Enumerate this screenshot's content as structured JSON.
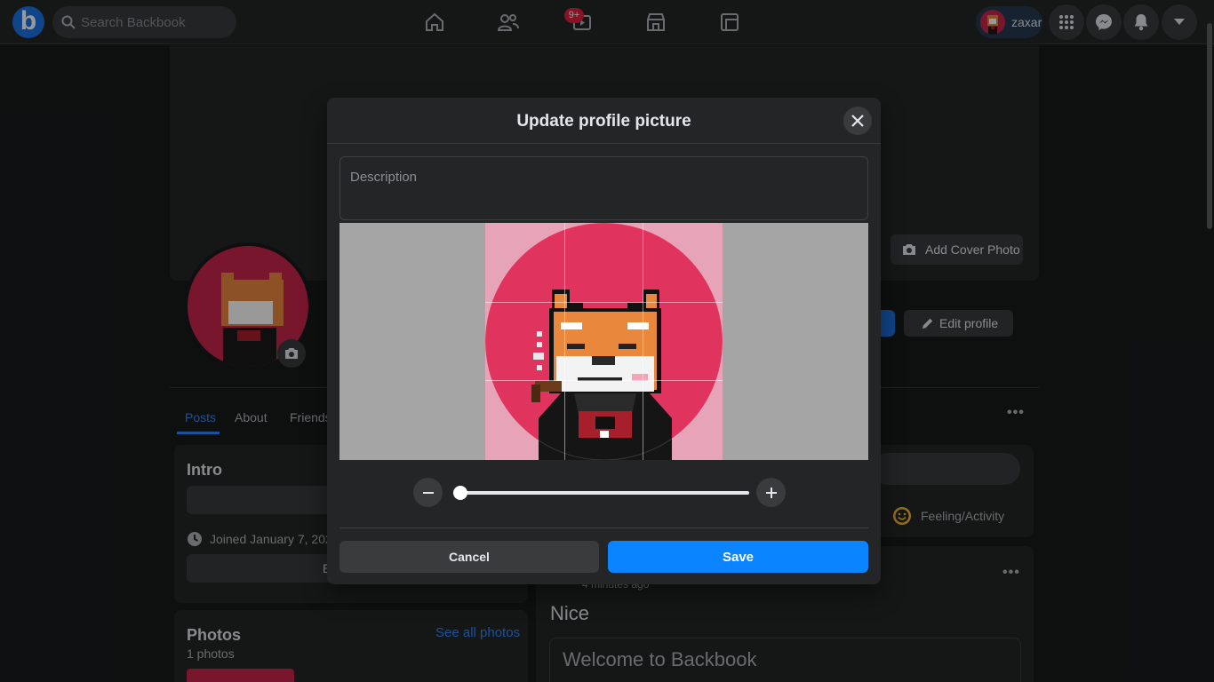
{
  "app": {
    "logo_letter": "b",
    "search_placeholder": "Search Backbook",
    "notification_badge": "9+",
    "username": "zaxar",
    "icons": [
      "home-icon",
      "friends-icon",
      "watch-icon",
      "marketplace-icon",
      "groups-icon",
      "menu-grid-icon",
      "messenger-icon",
      "bell-icon",
      "caret-down-icon"
    ]
  },
  "profile": {
    "add_cover_label": "Add Cover Photo",
    "edit_profile_label": "Edit profile",
    "tabs": [
      "Posts",
      "About",
      "Friends"
    ],
    "active_tab": "Posts"
  },
  "intro": {
    "title": "Intro",
    "joined": "Joined January 7, 2023",
    "edit_button_fragment": "E"
  },
  "photos": {
    "title": "Photos",
    "see_all": "See all photos",
    "count": "1 photos"
  },
  "composer": {
    "feeling_label": "Feeling/Activity"
  },
  "post": {
    "time": "4 minutes ago",
    "text": "Nice",
    "link_card_title": "Welcome to Backbook"
  },
  "modal": {
    "title": "Update profile picture",
    "description_placeholder": "Description",
    "zoom_level": 0,
    "cancel_label": "Cancel",
    "save_label": "Save"
  },
  "colors": {
    "accent": "#0a84ff",
    "link": "#2d88ff",
    "avatar_bg": "#e0335d"
  }
}
